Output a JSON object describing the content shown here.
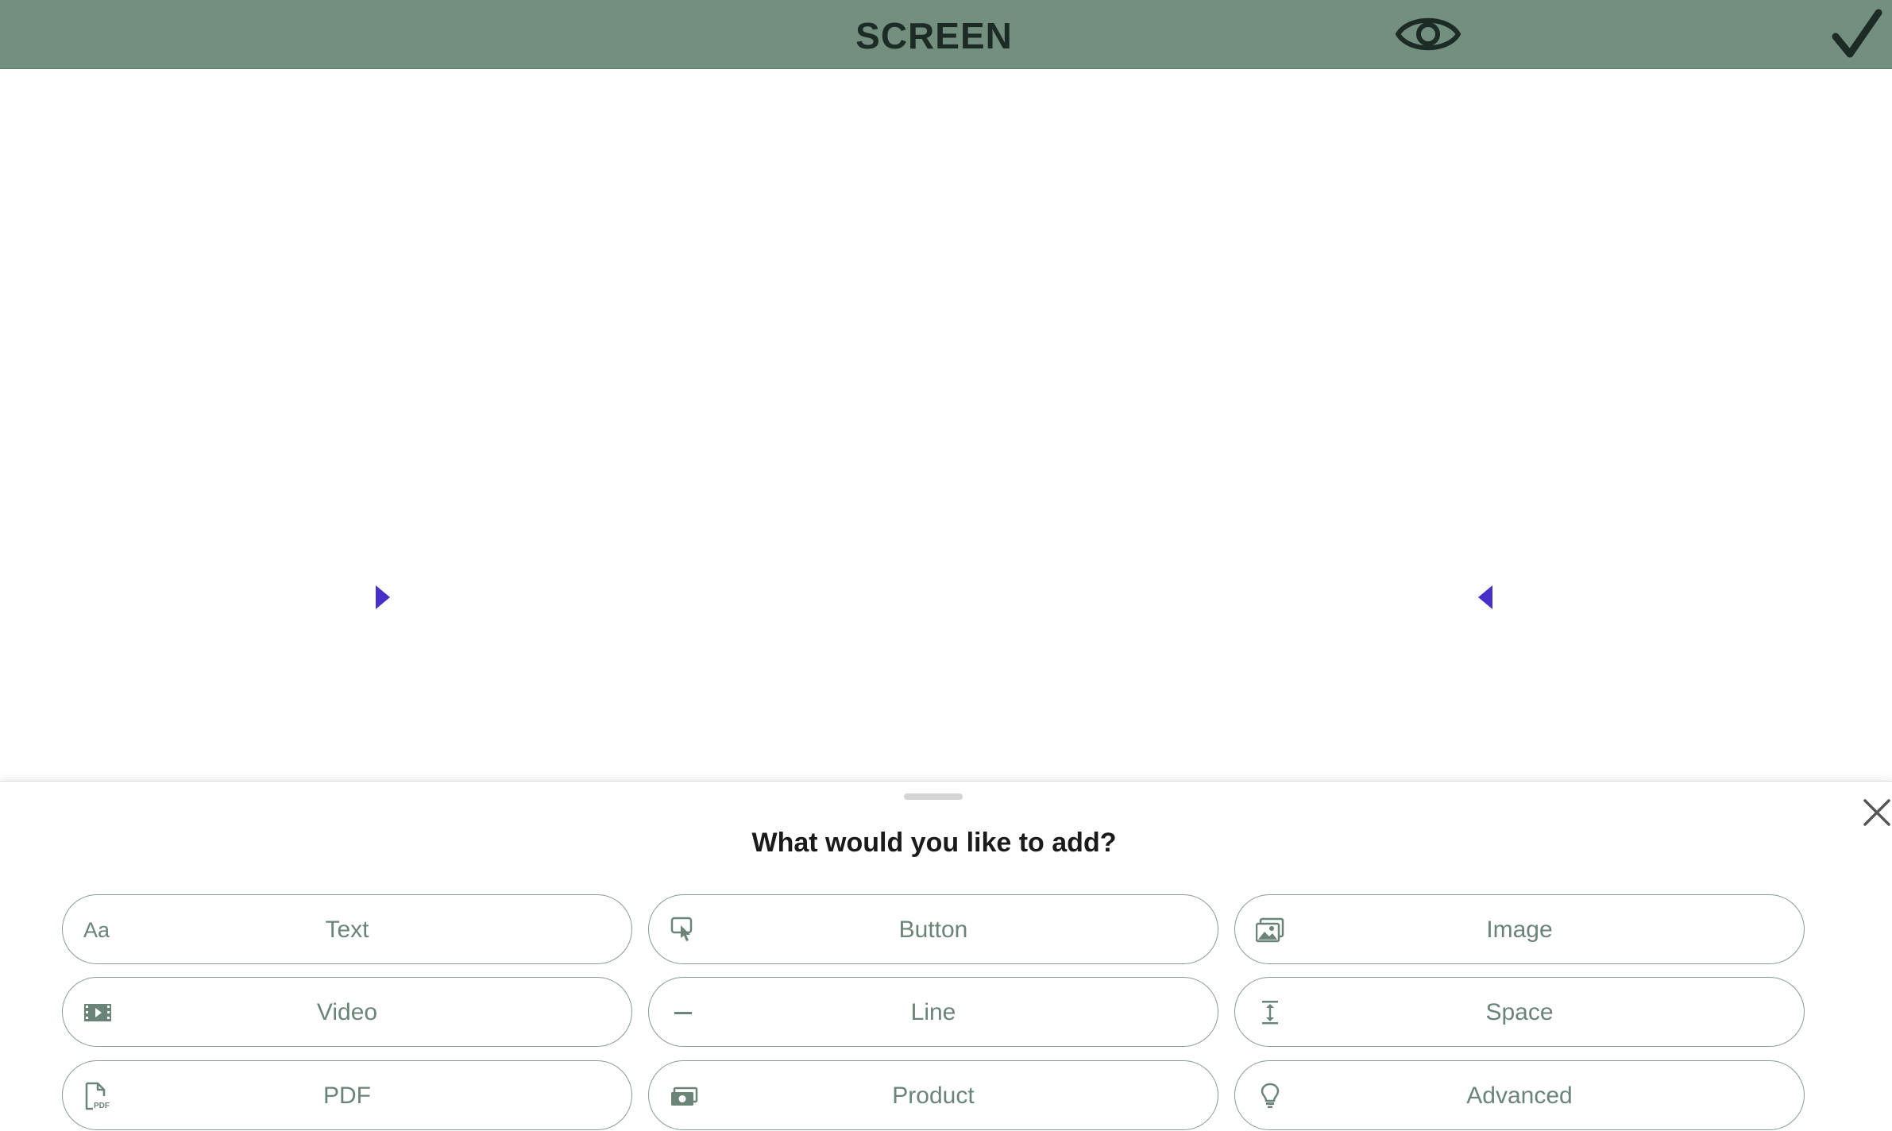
{
  "header": {
    "title": "SCREEN",
    "preview_icon": "eye-icon",
    "confirm_icon": "checkmark-icon",
    "background_color": "#738f80"
  },
  "canvas": {
    "cursor_color": "#4430c9"
  },
  "sheet": {
    "title": "What would you like to add?",
    "close_icon": "close-icon",
    "accent_color": "#6b8478",
    "options": [
      {
        "label": "Text",
        "icon": "text-aa-icon"
      },
      {
        "label": "Button",
        "icon": "button-tap-icon"
      },
      {
        "label": "Image",
        "icon": "image-icon"
      },
      {
        "label": "Video",
        "icon": "video-film-icon"
      },
      {
        "label": "Line",
        "icon": "line-icon"
      },
      {
        "label": "Space",
        "icon": "space-height-icon"
      },
      {
        "label": "PDF",
        "icon": "pdf-file-icon"
      },
      {
        "label": "Product",
        "icon": "product-money-icon"
      },
      {
        "label": "Advanced",
        "icon": "lightbulb-icon"
      }
    ]
  }
}
